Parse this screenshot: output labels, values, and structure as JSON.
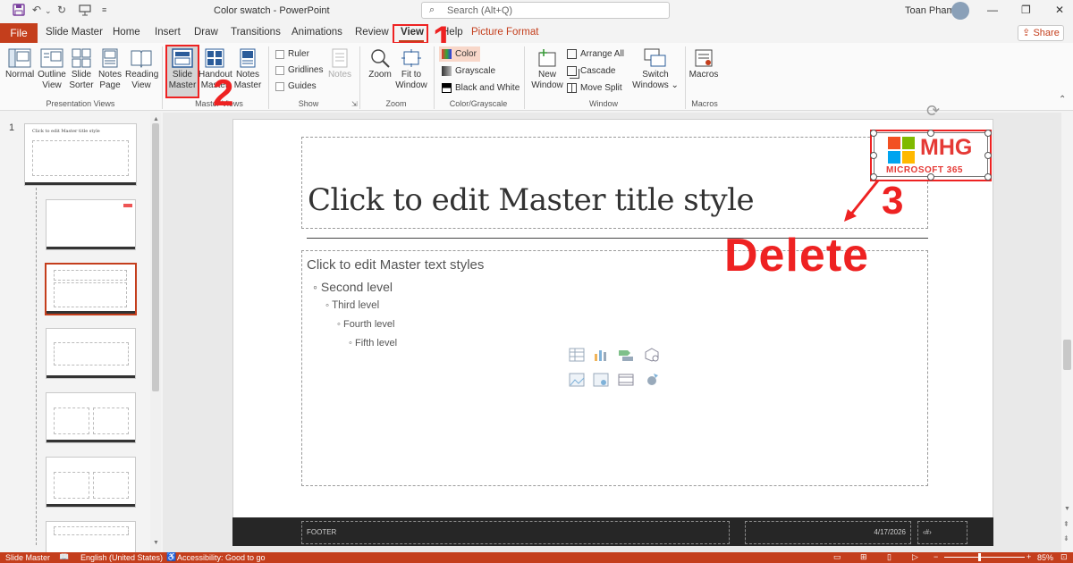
{
  "titlebar": {
    "doc_title": "Color swatch  -  PowerPoint",
    "search_placeholder": "Search (Alt+Q)",
    "user_name": "Toan Pham"
  },
  "tabs": {
    "file": "File",
    "items": [
      "Slide Master",
      "Home",
      "Insert",
      "Draw",
      "Transitions",
      "Animations",
      "Review",
      "View",
      "Help",
      "Picture Format"
    ],
    "share": "Share",
    "active": "View",
    "contextual_color": "#c43e1c"
  },
  "ribbon": {
    "presentation_views": {
      "label": "Presentation Views",
      "normal": "Normal",
      "outline": "Outline View",
      "sorter": "Slide Sorter",
      "notes_page": "Notes Page",
      "reading": "Reading View"
    },
    "master_views": {
      "label": "Master Views",
      "slide_master": "Slide Master",
      "handout": "Handout Master",
      "notes_master": "Notes Master"
    },
    "show": {
      "label": "Show",
      "ruler": "Ruler",
      "gridlines": "Gridlines",
      "guides": "Guides",
      "notes": "Notes"
    },
    "zoom": {
      "label": "Zoom",
      "zoom": "Zoom",
      "fit": "Fit to Window"
    },
    "color": {
      "label": "Color/Grayscale",
      "color": "Color",
      "grayscale": "Grayscale",
      "bw": "Black and White"
    },
    "window": {
      "label": "Window",
      "new_window": "New Window",
      "arrange_all": "Arrange All",
      "cascade": "Cascade",
      "move_split": "Move Split",
      "switch": "Switch Windows"
    },
    "macros": {
      "label": "Macros",
      "macros": "Macros"
    }
  },
  "annotations": {
    "step1": "1",
    "step2": "2",
    "step3": "3",
    "delete": "Delete",
    "color": "#e22222"
  },
  "slides_pane": {
    "slide_number": "1",
    "thumb_title": "Click to edit Master title style"
  },
  "slide": {
    "title": "Click to edit Master title style",
    "body": {
      "level1": "Click to edit Master text styles",
      "level2": "Second level",
      "level3": "Third level",
      "level4": "Fourth level",
      "level5": "Fifth level"
    },
    "footer": "FOOTER",
    "date": "4/17/2026",
    "page_number": "‹#›",
    "logo_text": "MHG",
    "logo_sub": "MICROSOFT 365"
  },
  "status": {
    "view": "Slide Master",
    "language": "English (United States)",
    "accessibility": "Accessibility: Good to go",
    "zoom": "85%"
  }
}
